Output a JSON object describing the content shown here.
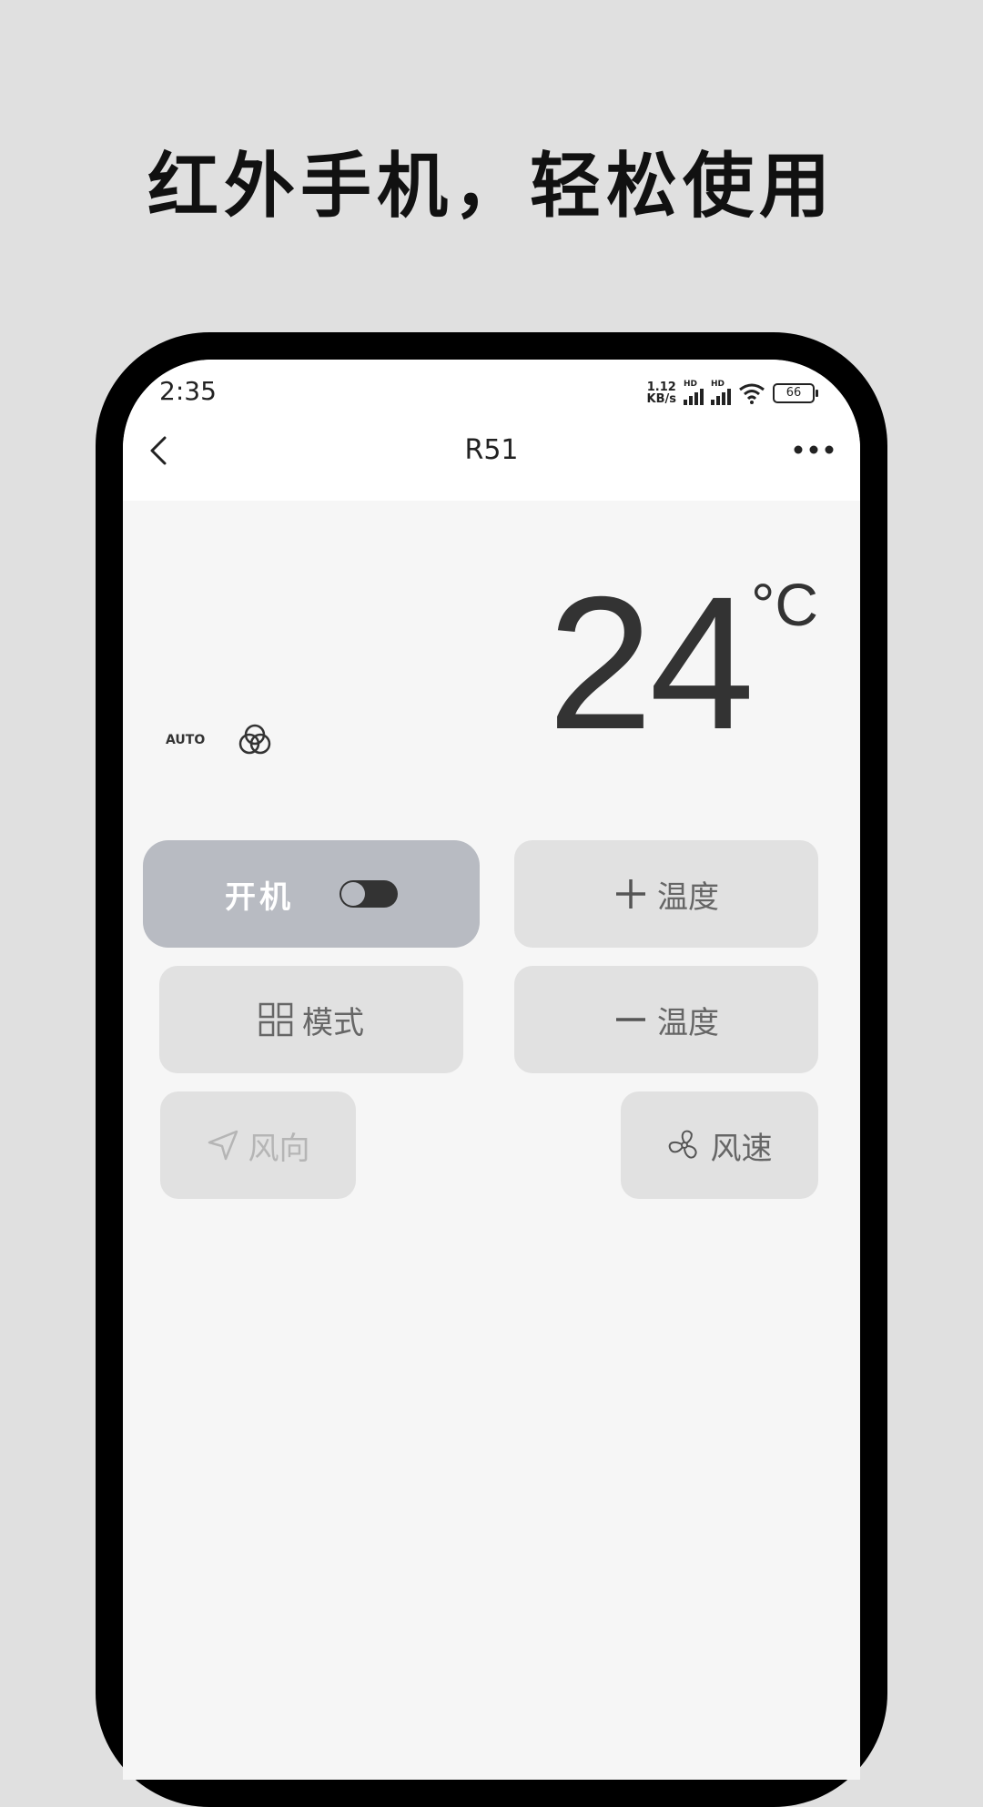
{
  "promo": {
    "headline": "红外手机，轻松使用"
  },
  "status_bar": {
    "time": "2:35",
    "net_speed_value": "1.12",
    "net_speed_unit": "KB/s",
    "sim1_label": "HD",
    "sim2_label": "HD",
    "battery": "66"
  },
  "nav": {
    "back_icon": "chevron-left-icon",
    "title": "R51",
    "more_icon": "more-horizontal-icon"
  },
  "display": {
    "temperature": "24",
    "unit": "°C",
    "mode_label": "AUTO",
    "mode_icon": "swirl-icon"
  },
  "controls": {
    "power_label": "开机",
    "power_on": false,
    "temp_up_label": "温度",
    "temp_up_icon": "plus-icon",
    "temp_down_label": "温度",
    "temp_down_icon": "minus-icon",
    "mode_label": "模式",
    "mode_icon": "grid-icon",
    "swing_label": "风向",
    "swing_icon": "navigation-arrow-icon",
    "swing_enabled": false,
    "fan_label": "风速",
    "fan_icon": "fan-icon"
  },
  "colors": {
    "page_background": "#e0e0e0",
    "screen_background": "#f6f6f6",
    "button_background": "#e1e1e1",
    "power_button_background": "#b8bbc2",
    "text_dark": "#333333"
  }
}
